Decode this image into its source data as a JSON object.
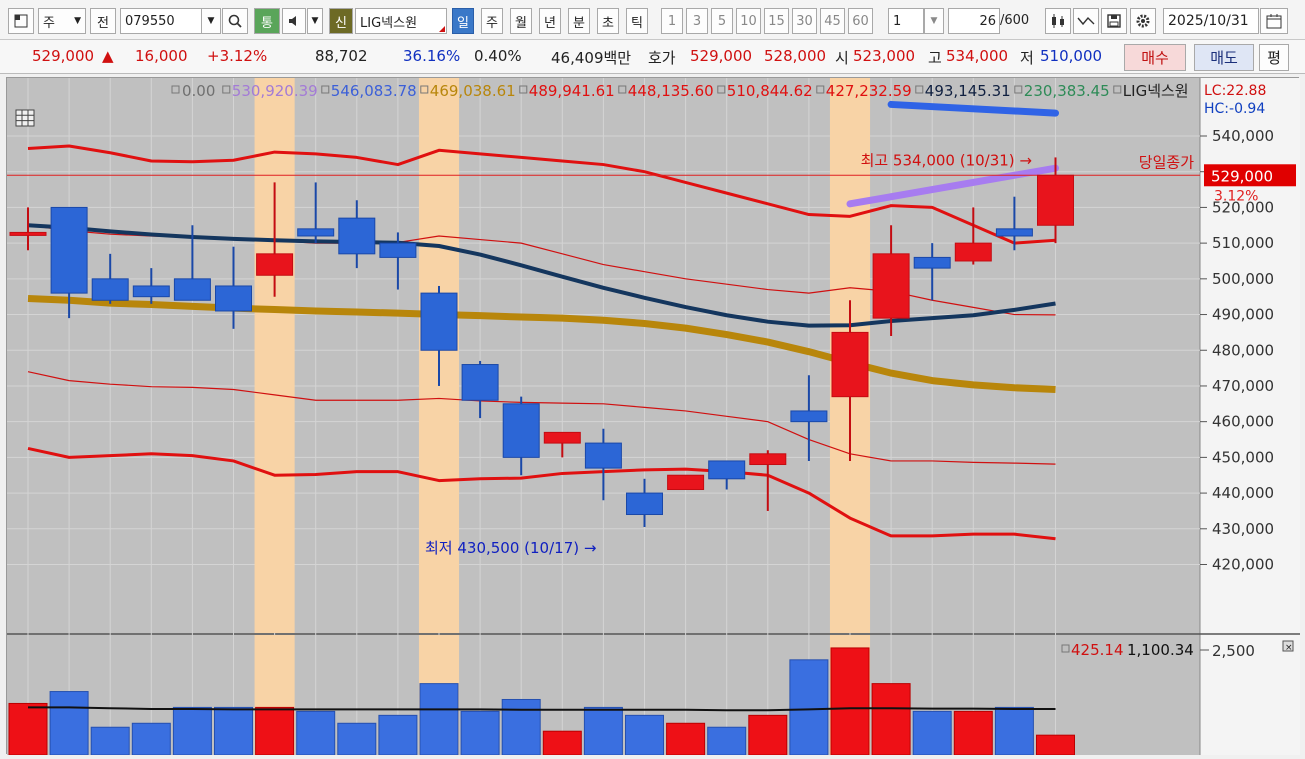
{
  "toolbar": {
    "type_label": "주",
    "prev_label": "전",
    "code": "079550",
    "tong_label": "통",
    "sin_label": "신",
    "stock_name": "LIG넥스원",
    "periods": [
      "일",
      "주",
      "월",
      "년",
      "분",
      "초",
      "틱"
    ],
    "intervals": [
      "1",
      "3",
      "5",
      "10",
      "15",
      "30",
      "45",
      "60"
    ],
    "interval_value": "1",
    "count": "26",
    "count_total": "/600",
    "date": "2025/10/31"
  },
  "quote": {
    "price": "529,000",
    "change_arrow": "▲",
    "change": "16,000",
    "change_pct": "+3.12%",
    "volume": "88,702",
    "turnover_pct": "36.16%",
    "ratio": "0.40%",
    "amount": "46,409백만",
    "hoga_label": "호가",
    "ask": "529,000",
    "bid": "528,000",
    "open_label": "시",
    "open": "523,000",
    "high_label": "고",
    "high": "534,000",
    "low_label": "저",
    "low": "510,000",
    "buy_label": "매수",
    "sell_label": "매도",
    "eval_label": "평"
  },
  "legend": {
    "items": [
      {
        "text": "0.00",
        "color": "#707070"
      },
      {
        "text": "530,920.39",
        "color": "#a37bd6"
      },
      {
        "text": "546,083.78",
        "color": "#3b5fd8"
      },
      {
        "text": "469,038.61",
        "color": "#b8860b"
      },
      {
        "text": "489,941.61",
        "color": "#e01010"
      },
      {
        "text": "448,135.60",
        "color": "#e01010"
      },
      {
        "text": "510,844.62",
        "color": "#e01010"
      },
      {
        "text": "427,232.59",
        "color": "#e01010"
      },
      {
        "text": "493,145.31",
        "color": "#102040"
      },
      {
        "text": "230,383.45",
        "color": "#2e8b57"
      },
      {
        "text": "LIG넥스원",
        "color": "#222222"
      }
    ],
    "lc": "LC:22.88",
    "hc": "HC:-0.94"
  },
  "annotations": {
    "high": "최고 534,000 (10/31) →",
    "low": "최저 430,500 (10/17) →",
    "close_label": "당일종가",
    "price_tag": "529,000",
    "pct_tag": "3.12%"
  },
  "volume_panel": {
    "value1": "425.14",
    "value2": "1,100.34",
    "axis_label": "2,500"
  },
  "chart_data": {
    "type": "candlestick",
    "price_axis": {
      "min": 410000,
      "max": 550000,
      "ticks": [
        420000,
        430000,
        440000,
        450000,
        460000,
        470000,
        480000,
        490000,
        500000,
        510000,
        520000,
        530000,
        540000
      ]
    },
    "price_tick_labels": [
      "420,000",
      "430,000",
      "440,000",
      "450,000",
      "460,000",
      "470,000",
      "480,000",
      "490,000",
      "500,000",
      "510,000",
      "520,000",
      "530,000",
      "540,000"
    ],
    "candles": [
      {
        "o": 513000,
        "h": 520000,
        "l": 508000,
        "c": 513000
      },
      {
        "o": 520000,
        "h": 520000,
        "l": 489000,
        "c": 496000
      },
      {
        "o": 500000,
        "h": 507000,
        "l": 493000,
        "c": 494000
      },
      {
        "o": 498000,
        "h": 503000,
        "l": 493000,
        "c": 495000
      },
      {
        "o": 500000,
        "h": 515000,
        "l": 494000,
        "c": 494000
      },
      {
        "o": 498000,
        "h": 509000,
        "l": 486000,
        "c": 491000
      },
      {
        "o": 501000,
        "h": 527000,
        "l": 495000,
        "c": 507000
      },
      {
        "o": 514000,
        "h": 527000,
        "l": 510000,
        "c": 512000
      },
      {
        "o": 517000,
        "h": 522000,
        "l": 503000,
        "c": 507000
      },
      {
        "o": 510000,
        "h": 513000,
        "l": 497000,
        "c": 506000
      },
      {
        "o": 496000,
        "h": 498000,
        "l": 470000,
        "c": 480000
      },
      {
        "o": 476000,
        "h": 477000,
        "l": 461000,
        "c": 466000
      },
      {
        "o": 465000,
        "h": 467000,
        "l": 445000,
        "c": 450000
      },
      {
        "o": 454000,
        "h": 457000,
        "l": 450000,
        "c": 457000
      },
      {
        "o": 454000,
        "h": 458000,
        "l": 438000,
        "c": 447000
      },
      {
        "o": 440000,
        "h": 444000,
        "l": 430500,
        "c": 434000
      },
      {
        "o": 441000,
        "h": 445000,
        "l": 441000,
        "c": 445000
      },
      {
        "o": 449000,
        "h": 449000,
        "l": 441000,
        "c": 444000
      },
      {
        "o": 448000,
        "h": 452000,
        "l": 435000,
        "c": 451000
      },
      {
        "o": 463000,
        "h": 473000,
        "l": 449000,
        "c": 460000
      },
      {
        "o": 467000,
        "h": 494000,
        "l": 449000,
        "c": 485000
      },
      {
        "o": 489000,
        "h": 515000,
        "l": 484000,
        "c": 507000
      },
      {
        "o": 506000,
        "h": 510000,
        "l": 494000,
        "c": 503000
      },
      {
        "o": 505000,
        "h": 520000,
        "l": 504000,
        "c": 510000
      },
      {
        "o": 514000,
        "h": 523000,
        "l": 508000,
        "c": 512000
      },
      {
        "o": 515000,
        "h": 534000,
        "l": 510000,
        "c": 529000
      }
    ],
    "volume": [
      1.3,
      1.6,
      0.7,
      0.8,
      1.2,
      1.2,
      1.2,
      1.1,
      0.8,
      1.0,
      1.8,
      1.1,
      1.4,
      0.6,
      1.2,
      1.0,
      0.8,
      0.7,
      1.0,
      2.4,
      2.7,
      1.8,
      1.1,
      1.1,
      1.2,
      0.5
    ],
    "volume_up": [
      true,
      false,
      false,
      false,
      false,
      false,
      true,
      false,
      false,
      false,
      false,
      false,
      false,
      true,
      false,
      false,
      true,
      false,
      true,
      false,
      true,
      true,
      false,
      true,
      false,
      true
    ],
    "volume_avg": [
      1.2,
      1.2,
      1.18,
      1.16,
      1.16,
      1.15,
      1.15,
      1.15,
      1.15,
      1.15,
      1.15,
      1.15,
      1.14,
      1.14,
      1.14,
      1.14,
      1.14,
      1.13,
      1.13,
      1.15,
      1.18,
      1.18,
      1.17,
      1.17,
      1.16,
      1.16
    ],
    "volume_axis": {
      "max": 2.9
    },
    "ma_long": [
      494500,
      494000,
      493200,
      492800,
      492300,
      491800,
      491400,
      491000,
      490700,
      490400,
      490000,
      489700,
      489300,
      489000,
      488400,
      487500,
      486200,
      484400,
      482300,
      479600,
      476500,
      473600,
      471500,
      470300,
      469500,
      469000
    ],
    "ma_mid": [
      515000,
      514300,
      513300,
      512400,
      511700,
      511200,
      510800,
      510500,
      510300,
      510100,
      509200,
      506800,
      503800,
      500600,
      497500,
      494700,
      492100,
      489800,
      488000,
      486900,
      487000,
      488200,
      489000,
      489800,
      491300,
      493100
    ],
    "env_upper": [
      536500,
      537200,
      535300,
      533000,
      532800,
      533200,
      535500,
      535000,
      534000,
      532000,
      536000,
      535000,
      534000,
      533000,
      532000,
      530000,
      527000,
      524000,
      521000,
      518000,
      517500,
      520500,
      520000,
      515000,
      510000,
      510800
    ],
    "env_lower": [
      452500,
      450000,
      450500,
      451000,
      450500,
      449000,
      445000,
      445200,
      446000,
      446000,
      443500,
      444000,
      444200,
      445500,
      446000,
      446500,
      446700,
      446000,
      445000,
      440000,
      433000,
      428000,
      428000,
      428500,
      428500,
      427200
    ],
    "env_mid_upper": [
      515000,
      513500,
      512500,
      512000,
      511700,
      511300,
      510700,
      510000,
      510000,
      510200,
      512000,
      511000,
      510000,
      507000,
      504000,
      502000,
      500000,
      498500,
      497000,
      496000,
      497500,
      496500,
      494000,
      492000,
      490000,
      489900
    ],
    "env_mid_lower": [
      474000,
      471500,
      470500,
      469800,
      469600,
      469000,
      467500,
      466000,
      466000,
      466000,
      466500,
      465800,
      465400,
      465200,
      465000,
      464000,
      463000,
      461500,
      460000,
      455000,
      451000,
      449000,
      449000,
      448600,
      448400,
      448100
    ],
    "highlight_columns": [
      6,
      10,
      20
    ],
    "close_line": 529000,
    "trend_top": [
      [
        21,
        548000
      ],
      [
        25,
        545000
      ]
    ],
    "trend_purple": [
      [
        20,
        521000
      ],
      [
        25,
        531000
      ]
    ]
  }
}
